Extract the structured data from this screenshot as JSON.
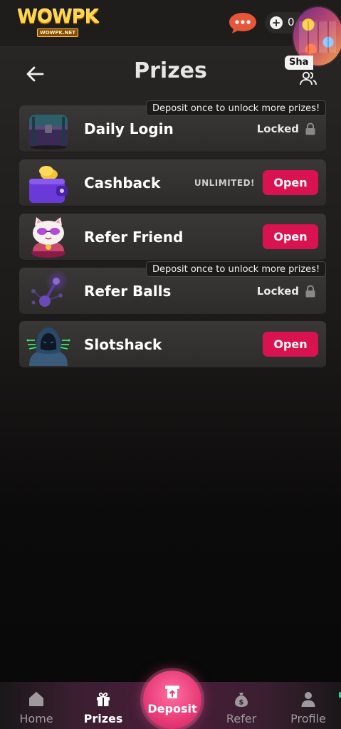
{
  "header": {
    "logo_text": "WOWPK",
    "logo_subtext": "WOWPK.NET",
    "balance": "0",
    "chat_icon": "chat-bubble-icon",
    "accent_color": "#e8563a"
  },
  "title_row": {
    "title": "Prizes",
    "share_label": "Sha"
  },
  "prizes": [
    {
      "name": "Daily Login",
      "status": "Locked",
      "action": "",
      "tooltip": "Deposit once to unlock more prizes!",
      "icon": "treasure-chest-icon"
    },
    {
      "name": "Cashback",
      "status": "UNLIMITED!",
      "action": "Open",
      "tooltip": "",
      "icon": "wallet-coins-icon"
    },
    {
      "name": "Refer Friend",
      "status": "",
      "action": "Open",
      "tooltip": "",
      "icon": "lucky-cat-icon"
    },
    {
      "name": "Refer Balls",
      "status": "Locked",
      "action": "",
      "tooltip": "Deposit once to unlock more prizes!",
      "icon": "balls-network-icon"
    },
    {
      "name": "Slotshack",
      "status": "",
      "action": "Open",
      "tooltip": "",
      "icon": "hooded-figure-icon"
    }
  ],
  "nav": {
    "home": "Home",
    "prizes": "Prizes",
    "deposit": "Deposit",
    "refer": "Refer",
    "profile": "Profile",
    "active": "Prizes"
  },
  "colors": {
    "open_button": "#d9134f",
    "deposit_button": "#e83a76"
  }
}
